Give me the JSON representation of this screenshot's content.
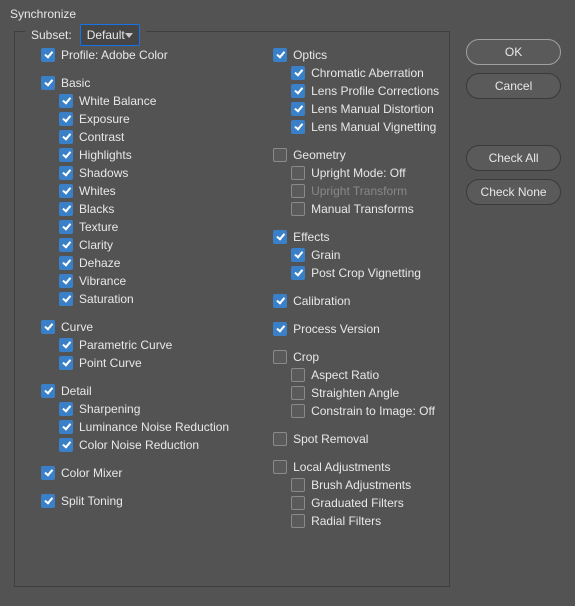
{
  "window": {
    "title": "Synchronize"
  },
  "subset": {
    "label": "Subset:",
    "value": "Default"
  },
  "buttons": {
    "ok": "OK",
    "cancel": "Cancel",
    "check_all": "Check All",
    "check_none": "Check None"
  },
  "left": [
    {
      "label": "Profile: Adobe Color",
      "checked": true,
      "children": []
    },
    {
      "label": "Basic",
      "checked": true,
      "children": [
        {
          "label": "White Balance",
          "checked": true
        },
        {
          "label": "Exposure",
          "checked": true
        },
        {
          "label": "Contrast",
          "checked": true
        },
        {
          "label": "Highlights",
          "checked": true
        },
        {
          "label": "Shadows",
          "checked": true
        },
        {
          "label": "Whites",
          "checked": true
        },
        {
          "label": "Blacks",
          "checked": true
        },
        {
          "label": "Texture",
          "checked": true
        },
        {
          "label": "Clarity",
          "checked": true
        },
        {
          "label": "Dehaze",
          "checked": true
        },
        {
          "label": "Vibrance",
          "checked": true
        },
        {
          "label": "Saturation",
          "checked": true
        }
      ]
    },
    {
      "label": "Curve",
      "checked": true,
      "children": [
        {
          "label": "Parametric Curve",
          "checked": true
        },
        {
          "label": "Point Curve",
          "checked": true
        }
      ]
    },
    {
      "label": "Detail",
      "checked": true,
      "children": [
        {
          "label": "Sharpening",
          "checked": true
        },
        {
          "label": "Luminance Noise Reduction",
          "checked": true
        },
        {
          "label": "Color Noise Reduction",
          "checked": true
        }
      ]
    },
    {
      "label": "Color Mixer",
      "checked": true,
      "children": []
    },
    {
      "label": "Split Toning",
      "checked": true,
      "children": []
    }
  ],
  "right": [
    {
      "label": "Optics",
      "checked": true,
      "children": [
        {
          "label": "Chromatic Aberration",
          "checked": true
        },
        {
          "label": "Lens Profile Corrections",
          "checked": true
        },
        {
          "label": "Lens Manual Distortion",
          "checked": true
        },
        {
          "label": "Lens Manual Vignetting",
          "checked": true
        }
      ]
    },
    {
      "label": "Geometry",
      "checked": false,
      "children": [
        {
          "label": "Upright Mode: Off",
          "checked": false
        },
        {
          "label": "Upright Transform",
          "checked": false,
          "disabled": true
        },
        {
          "label": "Manual Transforms",
          "checked": false
        }
      ]
    },
    {
      "label": "Effects",
      "checked": true,
      "children": [
        {
          "label": "Grain",
          "checked": true
        },
        {
          "label": "Post Crop Vignetting",
          "checked": true
        }
      ]
    },
    {
      "label": "Calibration",
      "checked": true,
      "children": []
    },
    {
      "label": "Process Version",
      "checked": true,
      "children": []
    },
    {
      "label": "Crop",
      "checked": false,
      "children": [
        {
          "label": "Aspect Ratio",
          "checked": false
        },
        {
          "label": "Straighten Angle",
          "checked": false
        },
        {
          "label": "Constrain to Image: Off",
          "checked": false
        }
      ]
    },
    {
      "label": "Spot Removal",
      "checked": false,
      "children": []
    },
    {
      "label": "Local Adjustments",
      "checked": false,
      "children": [
        {
          "label": "Brush Adjustments",
          "checked": false
        },
        {
          "label": "Graduated Filters",
          "checked": false
        },
        {
          "label": "Radial Filters",
          "checked": false
        }
      ]
    }
  ]
}
